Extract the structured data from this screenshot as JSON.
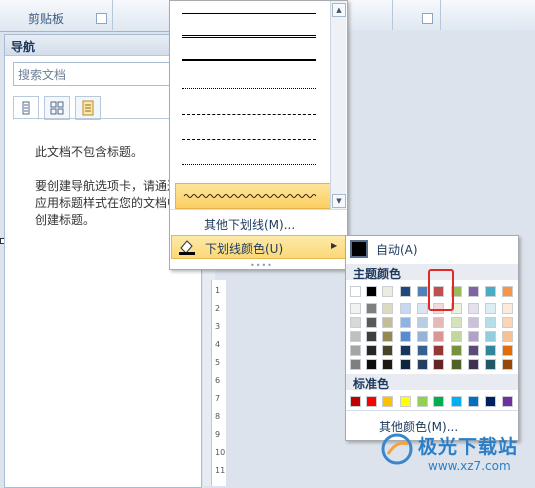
{
  "ribbon": {
    "clipboard_label": "剪贴板"
  },
  "nav": {
    "title": "导航",
    "search_placeholder": "搜索文档",
    "no_headings": "此文档不包含标题。",
    "hint_lines": [
      "要创建导航选项卡，请通过",
      "应用标题样式在您的文档中",
      "创建标题。"
    ]
  },
  "ruler": {
    "numbers": [
      "1",
      "2",
      "3",
      "4",
      "5",
      "6",
      "7",
      "8",
      "9",
      "10",
      "11"
    ]
  },
  "underline_menu": {
    "more_underlines": "其他下划线(M)...",
    "underline_color": "下划线颜色(U)"
  },
  "color_menu": {
    "auto": "自动(A)",
    "theme_colors_header": "主题颜色",
    "standard_colors_header": "标准色",
    "more_colors": "其他颜色(M)...",
    "theme_top": [
      "#ffffff",
      "#000000",
      "#eeece1",
      "#1f497d",
      "#4f81bd",
      "#c0504d",
      "#9bbb59",
      "#8064a2",
      "#4bacc6",
      "#f79646"
    ],
    "theme_shades": [
      [
        "#f2f2f2",
        "#7f7f7f",
        "#ddd9c3",
        "#c6d9f0",
        "#dbe5f1",
        "#f2dcdb",
        "#ebf1dd",
        "#e5e0ec",
        "#dbeef3",
        "#fdeada"
      ],
      [
        "#d8d8d8",
        "#595959",
        "#c4bd97",
        "#8db3e2",
        "#b8cce4",
        "#e5b9b7",
        "#d7e3bc",
        "#ccc1d9",
        "#b7dde8",
        "#fbd5b5"
      ],
      [
        "#bfbfbf",
        "#3f3f3f",
        "#938953",
        "#548dd4",
        "#95b3d7",
        "#d99694",
        "#c3d69b",
        "#b2a2c7",
        "#92cddc",
        "#fac08f"
      ],
      [
        "#a5a5a5",
        "#262626",
        "#494429",
        "#17365d",
        "#366092",
        "#953734",
        "#76923c",
        "#5f497a",
        "#31859b",
        "#e36c09"
      ],
      [
        "#7f7f7f",
        "#0c0c0c",
        "#1d1b10",
        "#0f243e",
        "#244061",
        "#632423",
        "#4f6128",
        "#3f3151",
        "#205867",
        "#974806"
      ]
    ],
    "standard": [
      "#c00000",
      "#ff0000",
      "#ffc000",
      "#ffff00",
      "#92d050",
      "#00b050",
      "#00b0f0",
      "#0070c0",
      "#002060",
      "#7030a0"
    ],
    "selected_color": "#c0504d"
  },
  "watermark": {
    "text": "极光下载站",
    "url": "www.xz7.com"
  }
}
